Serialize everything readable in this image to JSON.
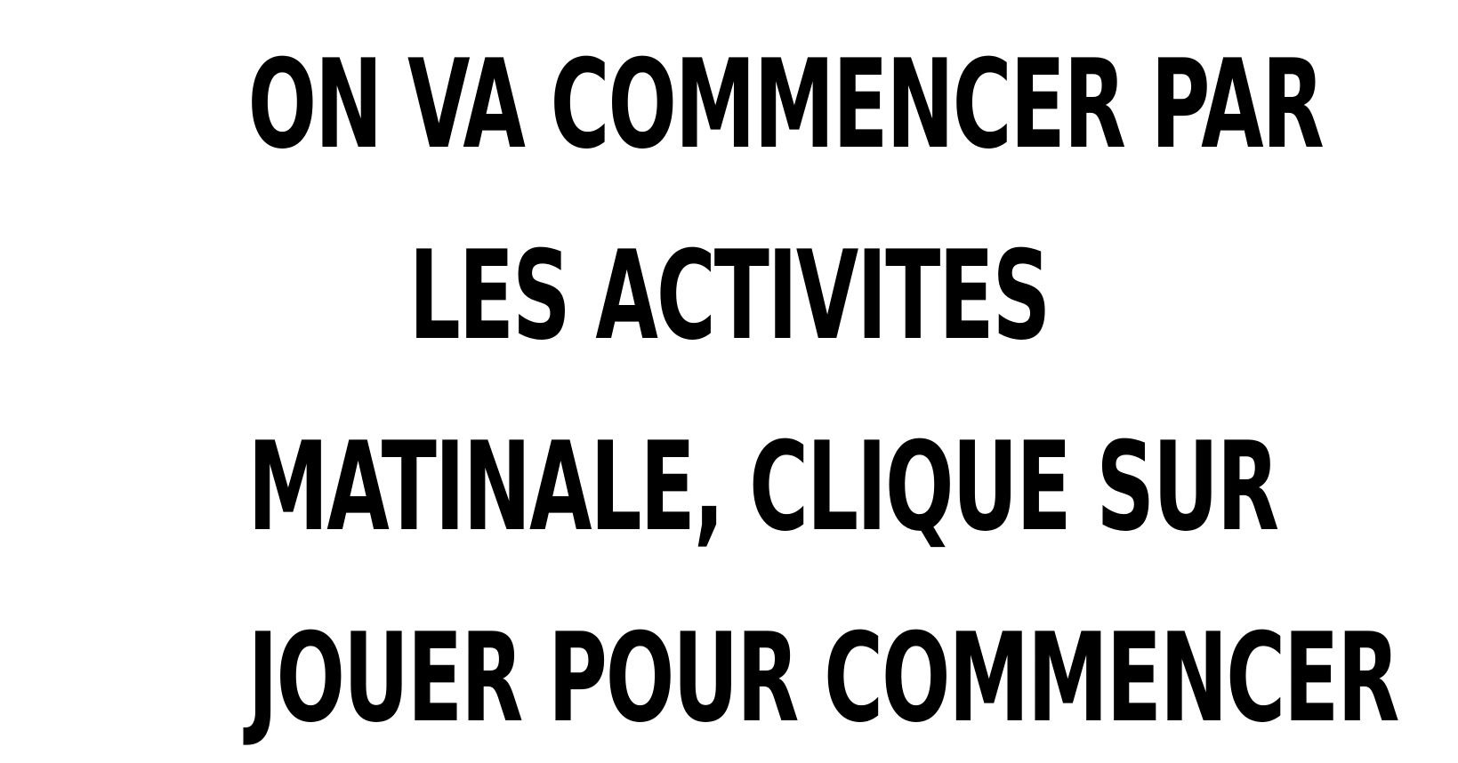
{
  "instruction": {
    "lines": [
      "ON VA COMMENCER PAR",
      "LES ACTIVITES",
      "MATINALE, CLIQUE SUR",
      "JOUER POUR COMMENCER"
    ]
  },
  "colors": {
    "background": "#ffffff",
    "text": "#000000"
  }
}
